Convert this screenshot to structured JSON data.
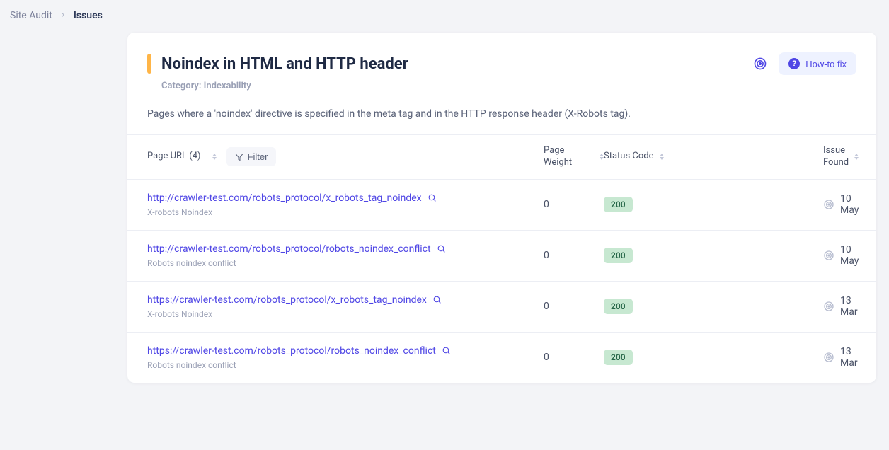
{
  "breadcrumb": {
    "parent": "Site Audit",
    "current": "Issues"
  },
  "header": {
    "title": "Noindex in HTML and HTTP header",
    "category": "Category: Indexability",
    "description": "Pages where a 'noindex' directive is specified in the meta tag and in the HTTP response header (X-Robots tag).",
    "howto_label": "How-to fix"
  },
  "table": {
    "columns": {
      "url": "Page URL (4)",
      "weight": "Page Weight",
      "status": "Status Code",
      "found": "Issue Found"
    },
    "filter_label": "Filter",
    "rows": [
      {
        "url": "http://crawler-test.com/robots_protocol/x_robots_tag_noindex",
        "subtitle": "X-robots Noindex",
        "weight": "0",
        "status": "200",
        "found": "10 May"
      },
      {
        "url": "http://crawler-test.com/robots_protocol/robots_noindex_conflict",
        "subtitle": "Robots noindex conflict",
        "weight": "0",
        "status": "200",
        "found": "10 May"
      },
      {
        "url": "https://crawler-test.com/robots_protocol/x_robots_tag_noindex",
        "subtitle": "X-robots Noindex",
        "weight": "0",
        "status": "200",
        "found": "13 Mar"
      },
      {
        "url": "https://crawler-test.com/robots_protocol/robots_noindex_conflict",
        "subtitle": "Robots noindex conflict",
        "weight": "0",
        "status": "200",
        "found": "13 Mar"
      }
    ]
  }
}
